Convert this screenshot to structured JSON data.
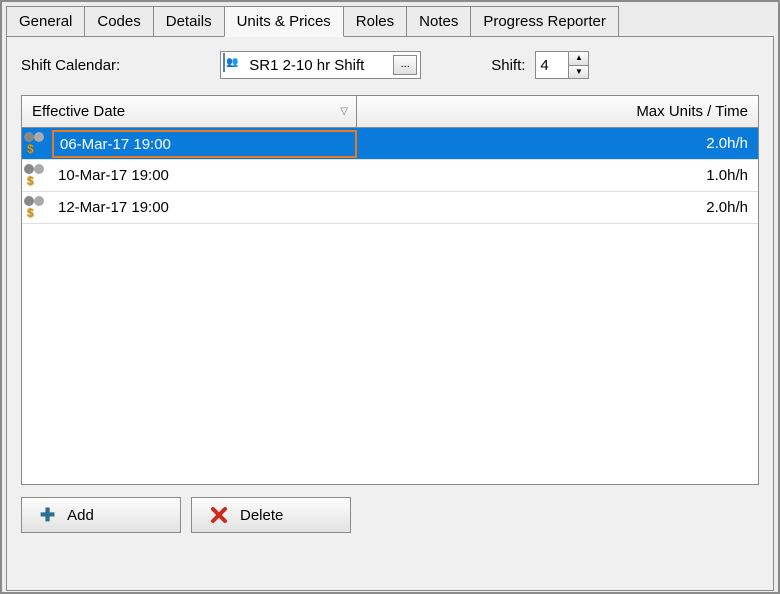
{
  "tabs": {
    "items": [
      {
        "label": "General"
      },
      {
        "label": "Codes"
      },
      {
        "label": "Details"
      },
      {
        "label": "Units & Prices"
      },
      {
        "label": "Roles"
      },
      {
        "label": "Notes"
      },
      {
        "label": "Progress Reporter"
      }
    ],
    "active_index": 3
  },
  "toolbar": {
    "shift_calendar_label": "Shift Calendar:",
    "shift_calendar_value": " SR1 2-10 hr Shift",
    "shift_label": "Shift:",
    "shift_value": "4"
  },
  "table": {
    "columns": {
      "date": "Effective Date",
      "max": "Max Units / Time"
    },
    "rows": [
      {
        "date": "06-Mar-17 19:00",
        "max": "2.0h/h",
        "selected": true
      },
      {
        "date": "10-Mar-17 19:00",
        "max": "1.0h/h",
        "selected": false
      },
      {
        "date": "12-Mar-17 19:00",
        "max": "2.0h/h",
        "selected": false
      }
    ]
  },
  "buttons": {
    "add": "Add",
    "delete": "Delete"
  }
}
